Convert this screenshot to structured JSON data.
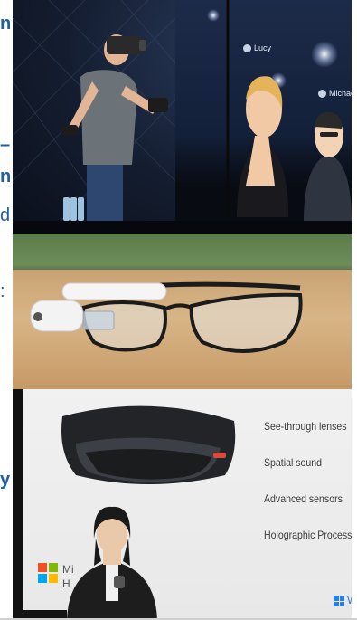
{
  "margin_text": {
    "fragments": [
      "n",
      "–",
      "n",
      "d",
      ":",
      "y"
    ]
  },
  "panels": {
    "keynote": {
      "avatar_names": [
        "Lucy",
        "Michael"
      ]
    },
    "hololens": {
      "features": [
        "See-through lenses",
        "Spatial sound",
        "Advanced sensors",
        "Holographic Processin"
      ],
      "brand_lines": [
        "Mi",
        "H"
      ],
      "windows_text": "W"
    }
  },
  "colors": {
    "margin_text": "#1f5fa6",
    "ms_red": "#f25022",
    "ms_green": "#7fba00",
    "ms_blue": "#00a4ef",
    "ms_yellow": "#ffb900",
    "windows_blue": "#2b7de0"
  }
}
